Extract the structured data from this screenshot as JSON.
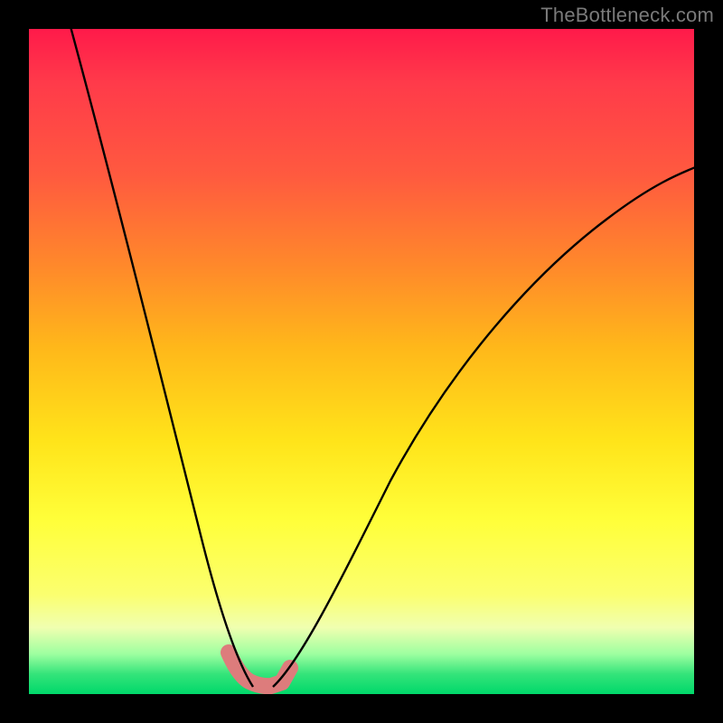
{
  "watermark": "TheBottleneck.com",
  "colors": {
    "black": "#000000",
    "curve": "#000000",
    "highlight": "#dd7c7c"
  },
  "chart_data": {
    "type": "line",
    "title": "",
    "xlabel": "",
    "ylabel": "",
    "xlim": [
      0,
      100
    ],
    "ylim": [
      0,
      100
    ],
    "series": [
      {
        "name": "left-curve",
        "x": [
          6,
          8,
          10,
          12,
          14,
          16,
          18,
          20,
          22,
          24,
          26,
          28,
          30,
          31,
          32,
          33
        ],
        "values": [
          100,
          90,
          80,
          70,
          61,
          52,
          44,
          36,
          29,
          22,
          16,
          10,
          5,
          3,
          1.5,
          0.5
        ]
      },
      {
        "name": "right-curve",
        "x": [
          37,
          38,
          40,
          42,
          45,
          48,
          52,
          56,
          62,
          68,
          75,
          82,
          90,
          100
        ],
        "values": [
          0.5,
          2,
          6,
          11,
          18,
          25,
          32,
          39,
          47,
          54,
          61,
          67,
          73,
          79
        ]
      },
      {
        "name": "highlight-segment",
        "x": [
          30,
          31,
          32,
          33,
          34,
          35,
          36,
          37,
          38
        ],
        "values": [
          6,
          3.5,
          1.5,
          0.5,
          0,
          0,
          0,
          0.5,
          2
        ],
        "stroke": "#dd7c7c",
        "stroke_width_px": 18
      }
    ]
  }
}
